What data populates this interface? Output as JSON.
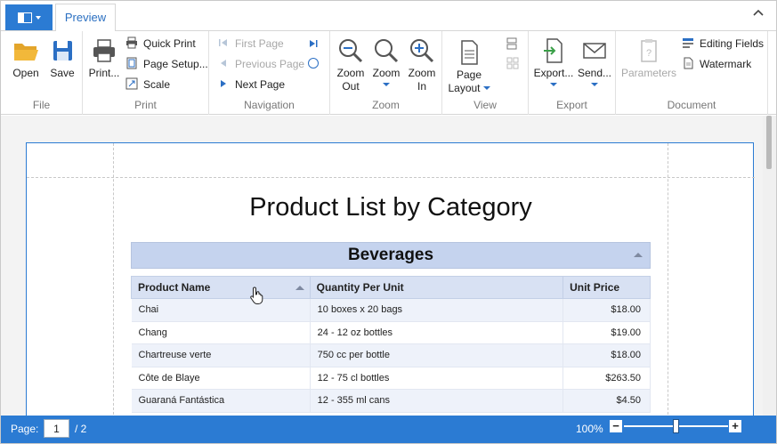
{
  "tabs": {
    "preview": "Preview"
  },
  "ribbon": {
    "file": {
      "label": "File",
      "open": "Open",
      "save": "Save"
    },
    "print": {
      "label": "Print",
      "print": "Print...",
      "quick_print": "Quick Print",
      "page_setup": "Page Setup...",
      "scale": "Scale"
    },
    "navigation": {
      "label": "Navigation",
      "first_page": "First Page",
      "previous_page": "Previous Page",
      "next_page": "Next Page"
    },
    "zoom": {
      "label": "Zoom",
      "zoom_out_1": "Zoom",
      "zoom_out_2": "Out",
      "zoom": "Zoom",
      "zoom_in_1": "Zoom",
      "zoom_in_2": "In"
    },
    "view": {
      "label": "View",
      "page_layout_1": "Page",
      "page_layout_2": "Layout"
    },
    "export": {
      "label": "Export",
      "export": "Export...",
      "send": "Send..."
    },
    "document": {
      "label": "Document",
      "parameters": "Parameters",
      "editing_fields": "Editing Fields",
      "watermark": "Watermark"
    }
  },
  "report": {
    "title": "Product List by Category",
    "category": "Beverages",
    "columns": [
      "Product Name",
      "Quantity Per Unit",
      "Unit Price"
    ],
    "rows": [
      [
        "Chai",
        "10 boxes x 20 bags",
        "$18.00"
      ],
      [
        "Chang",
        "24 - 12 oz bottles",
        "$19.00"
      ],
      [
        "Chartreuse verte",
        "750 cc per bottle",
        "$18.00"
      ],
      [
        "Côte de Blaye",
        "12 - 75 cl bottles",
        "$263.50"
      ],
      [
        "Guaraná Fantástica",
        "12 - 355 ml cans",
        "$4.50"
      ]
    ]
  },
  "status": {
    "page_label": "Page:",
    "page_current": "1",
    "page_total": "/ 2",
    "zoom": "100%",
    "zoom_level": 0.5
  },
  "colors": {
    "accent": "#2b7bd3",
    "header_band": "#c5d3ee"
  }
}
